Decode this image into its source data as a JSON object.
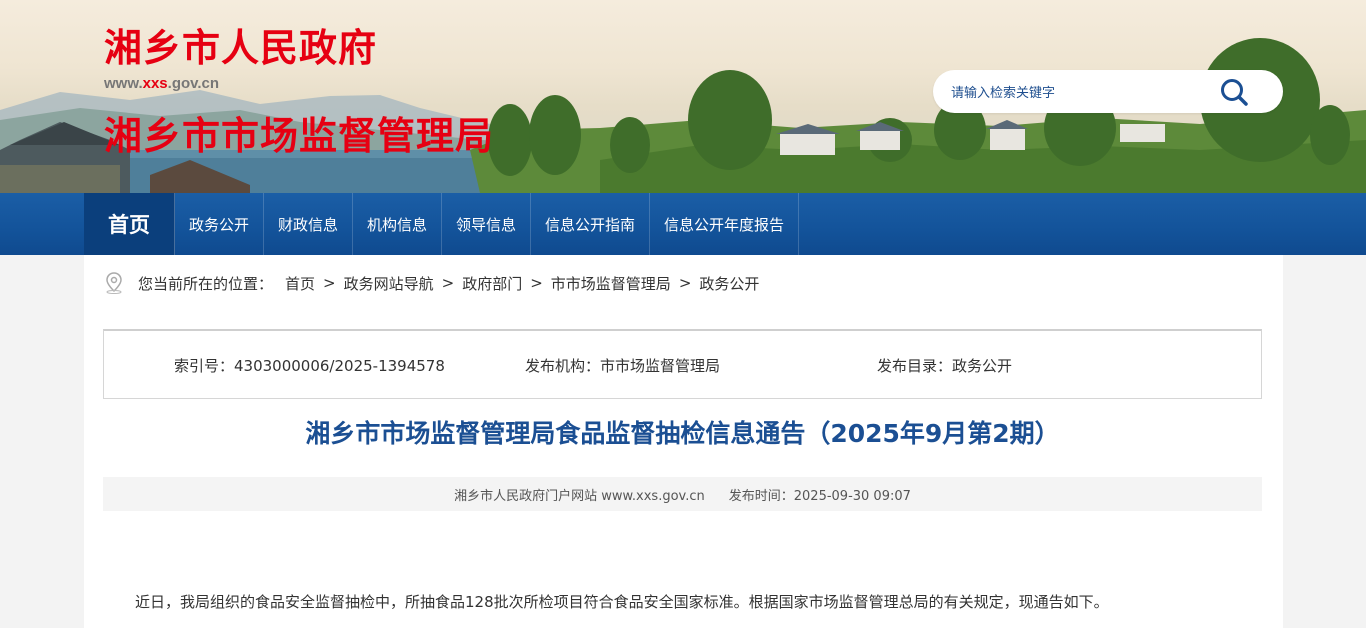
{
  "header": {
    "site_name": "湘乡市人民政府",
    "url_prefix": "www.",
    "url_highlight": "xxs",
    "url_suffix": ".gov.cn",
    "department_name": "湘乡市市场监督管理局",
    "search_placeholder": "请输入检索关键字"
  },
  "nav": {
    "home": "首页",
    "items": [
      "政务公开",
      "财政信息",
      "机构信息",
      "领导信息",
      "信息公开指南",
      "信息公开年度报告"
    ]
  },
  "breadcrumb": {
    "label": "您当前所在的位置：",
    "items": [
      "首页",
      "政务网站导航",
      "政府部门",
      "市市场监督管理局",
      "政务公开"
    ],
    "separator": ">"
  },
  "meta": {
    "index_no": "索引号：4303000006/2025-1394578",
    "publisher": "发布机构：市市场监督管理局",
    "catalog": "发布目录：政务公开"
  },
  "article": {
    "title": "湘乡市市场监督管理局食品监督抽检信息通告（2025年9月第2期）",
    "source": "湘乡市人民政府门户网站 www.xxs.gov.cn",
    "publish_time": "发布时间：2025-09-30 09:07",
    "first_paragraph": "近日，我局组织的食品安全监督抽检中，所抽食品128批次所检项目符合食品安全国家标准。根据国家市场监督管理总局的有关规定，现通告如下。"
  },
  "colors": {
    "brand_red": "#e60012",
    "nav_blue": "#13539a",
    "title_blue": "#1b4f93"
  }
}
